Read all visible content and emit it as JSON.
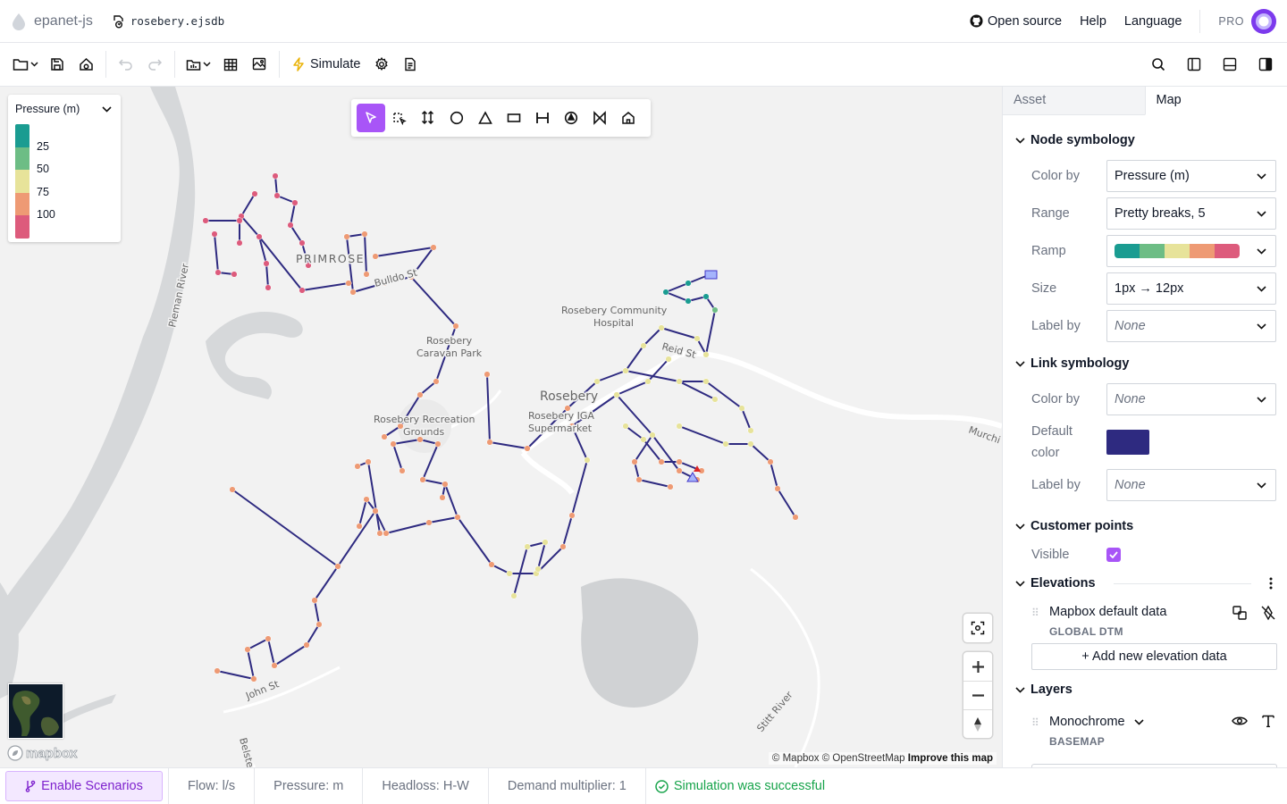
{
  "app": {
    "name": "epanet-js",
    "file_name": "rosebery.ejsdb"
  },
  "topbar": {
    "open_source": "Open source",
    "help": "Help",
    "language": "Language",
    "plan": "PRO"
  },
  "toolbar": {
    "simulate_label": "Simulate"
  },
  "legend": {
    "title": "Pressure (m)",
    "breaks": [
      "25",
      "50",
      "75",
      "100"
    ],
    "colors": [
      "#1a9c91",
      "#6dbd85",
      "#e7e39a",
      "#ee9a74",
      "#dd5b7c"
    ]
  },
  "map": {
    "labels": {
      "primrose": "PRIMROSE",
      "community": "Rosebery Community",
      "hospital": "Hospital",
      "caravan1": "Rosebery",
      "caravan2": "Caravan Park",
      "recreation1": "Rosebery Recreation",
      "recreation2": "Grounds",
      "town": "Rosebery",
      "supermarket1": "Rosebery IGA",
      "supermarket2": "Supermarket",
      "pieman": "Pieman River",
      "john": "John St",
      "stitt": "Stitt River",
      "murchison": "Murchi",
      "belstead": "Belste",
      "reid": "Reid St",
      "bulldo": "Bulldo St"
    },
    "attribution": {
      "mapbox": "© Mapbox",
      "osm": "© OpenStreetMap",
      "improve": "Improve this map"
    },
    "logo": "mapbox",
    "link_color": "#2e2a80"
  },
  "panel": {
    "tabs": [
      "Asset",
      "Map"
    ],
    "node_symbology": {
      "title": "Node symbology",
      "color_by_label": "Color by",
      "color_by_value": "Pressure (m)",
      "range_label": "Range",
      "range_value": "Pretty breaks, 5",
      "ramp_label": "Ramp",
      "size_label": "Size",
      "size_value": "1px → 12px",
      "label_by_label": "Label by",
      "label_by_value": "None"
    },
    "link_symbology": {
      "title": "Link symbology",
      "color_by_label": "Color by",
      "color_by_value": "None",
      "default_color_label_1": "Default",
      "default_color_label_2": "color",
      "default_color": "#2e2a80",
      "label_by_label": "Label by",
      "label_by_value": "None"
    },
    "customer_points": {
      "title": "Customer points",
      "visible_label": "Visible",
      "visible": true
    },
    "elevations": {
      "title": "Elevations",
      "item_name": "Mapbox default data",
      "item_sub": "GLOBAL DTM",
      "add_label": "+ Add new elevation data"
    },
    "layers": {
      "title": "Layers",
      "item_name": "Monochrome",
      "item_sub": "BASEMAP"
    }
  },
  "footer": {
    "scenarios": "Enable Scenarios",
    "flow": "Flow: l/s",
    "pressure": "Pressure: m",
    "headloss": "Headloss: H-W",
    "demand": "Demand multiplier: 1",
    "status": "Simulation was successful"
  }
}
